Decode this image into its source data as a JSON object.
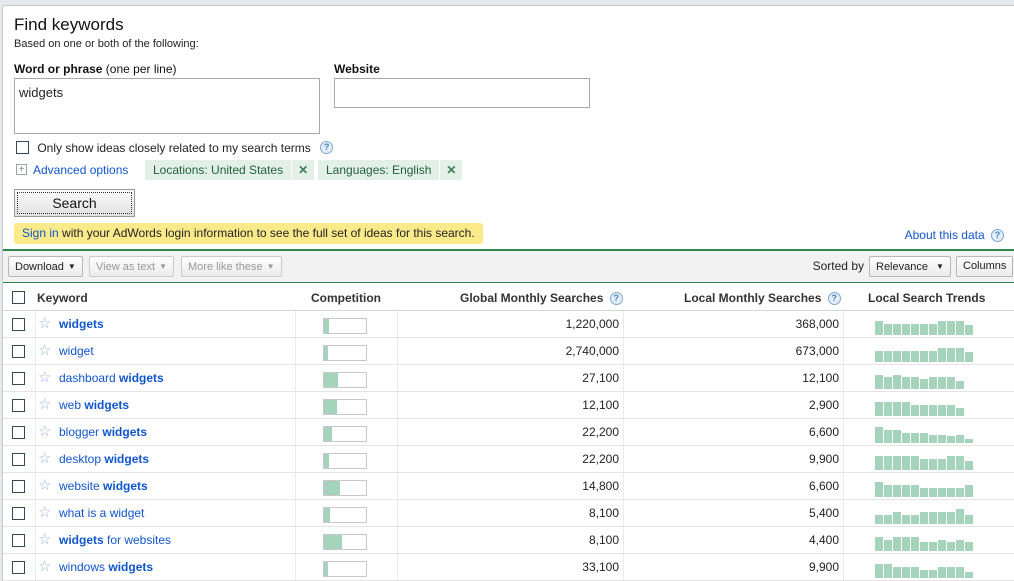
{
  "header": {
    "title": "Find keywords",
    "subtitle": "Based on one or both of the following:"
  },
  "form": {
    "word_label_bold": "Word or phrase",
    "word_label_rest": " (one per line)",
    "word_value": "widgets",
    "website_label": "Website",
    "website_value": "",
    "closely_label": "Only show ideas closely related to my search terms",
    "closely_checked": false,
    "advanced_label": "Advanced options",
    "chips": [
      {
        "label": "Locations: United States",
        "remove": "✕"
      },
      {
        "label": "Languages: English",
        "remove": "✕"
      }
    ],
    "search_label": "Search",
    "help_icon": "?"
  },
  "notice": {
    "link": "Sign in",
    "text": " with your AdWords login information to see the full set of ideas for this search."
  },
  "about_link": "About this data",
  "toolbar": {
    "download": "Download",
    "view_as_text": "View as text",
    "more_like_these": "More like these",
    "sorted_by": "Sorted by",
    "sort_value": "Relevance",
    "columns": "Columns"
  },
  "table": {
    "columns": {
      "keyword": "Keyword",
      "competition": "Competition",
      "global": "Global Monthly Searches",
      "local": "Local Monthly Searches",
      "trends": "Local Search Trends"
    },
    "rows": [
      {
        "prefix": "",
        "bold": "widgets",
        "suffix": "",
        "competition": 0.12,
        "global": "1,220,000",
        "local": "368,000",
        "trend": [
          0.9,
          0.7,
          0.7,
          0.7,
          0.7,
          0.7,
          0.7,
          0.9,
          0.9,
          0.9,
          0.6
        ]
      },
      {
        "prefix": "widget",
        "bold": "",
        "suffix": "",
        "competition": 0.09,
        "global": "2,740,000",
        "local": "673,000",
        "trend": [
          0.7,
          0.7,
          0.7,
          0.7,
          0.7,
          0.7,
          0.7,
          0.9,
          0.9,
          0.9,
          0.6
        ]
      },
      {
        "prefix": "dashboard ",
        "bold": "widgets",
        "suffix": "",
        "competition": 0.33,
        "global": "27,100",
        "local": "12,100",
        "trend": [
          0.9,
          0.75,
          0.9,
          0.75,
          0.75,
          0.6,
          0.75,
          0.75,
          0.75,
          0.5
        ]
      },
      {
        "prefix": "web ",
        "bold": "widgets",
        "suffix": "",
        "competition": 0.3,
        "global": "12,100",
        "local": "2,900",
        "trend": [
          0.9,
          0.9,
          0.9,
          0.9,
          0.7,
          0.7,
          0.7,
          0.7,
          0.7,
          0.5
        ]
      },
      {
        "prefix": "blogger ",
        "bold": "widgets",
        "suffix": "",
        "competition": 0.19,
        "global": "22,200",
        "local": "6,600",
        "trend": [
          1.0,
          0.8,
          0.8,
          0.6,
          0.6,
          0.6,
          0.5,
          0.5,
          0.45,
          0.5,
          0.25
        ]
      },
      {
        "prefix": "desktop ",
        "bold": "widgets",
        "suffix": "",
        "competition": 0.12,
        "global": "22,200",
        "local": "9,900",
        "trend": [
          0.9,
          0.9,
          0.9,
          0.9,
          0.9,
          0.7,
          0.7,
          0.7,
          0.9,
          0.9,
          0.55
        ]
      },
      {
        "prefix": "website ",
        "bold": "widgets",
        "suffix": "",
        "competition": 0.38,
        "global": "14,800",
        "local": "6,600",
        "trend": [
          0.95,
          0.75,
          0.75,
          0.75,
          0.75,
          0.55,
          0.55,
          0.55,
          0.55,
          0.55,
          0.75
        ]
      },
      {
        "prefix": "what is a widget",
        "bold": "",
        "suffix": "",
        "competition": 0.15,
        "global": "8,100",
        "local": "5,400",
        "trend": [
          0.55,
          0.55,
          0.75,
          0.55,
          0.55,
          0.75,
          0.75,
          0.75,
          0.75,
          0.95,
          0.55
        ]
      },
      {
        "prefix": "",
        "bold": "widgets",
        "suffix": " for websites",
        "competition": 0.43,
        "global": "8,100",
        "local": "4,400",
        "trend": [
          0.9,
          0.7,
          0.9,
          0.9,
          0.9,
          0.55,
          0.55,
          0.7,
          0.55,
          0.7,
          0.55
        ]
      },
      {
        "prefix": "windows ",
        "bold": "widgets",
        "suffix": "",
        "competition": 0.09,
        "global": "33,100",
        "local": "9,900",
        "trend": [
          0.9,
          0.9,
          0.7,
          0.7,
          0.7,
          0.5,
          0.5,
          0.7,
          0.7,
          0.7,
          0.4
        ]
      }
    ]
  }
}
